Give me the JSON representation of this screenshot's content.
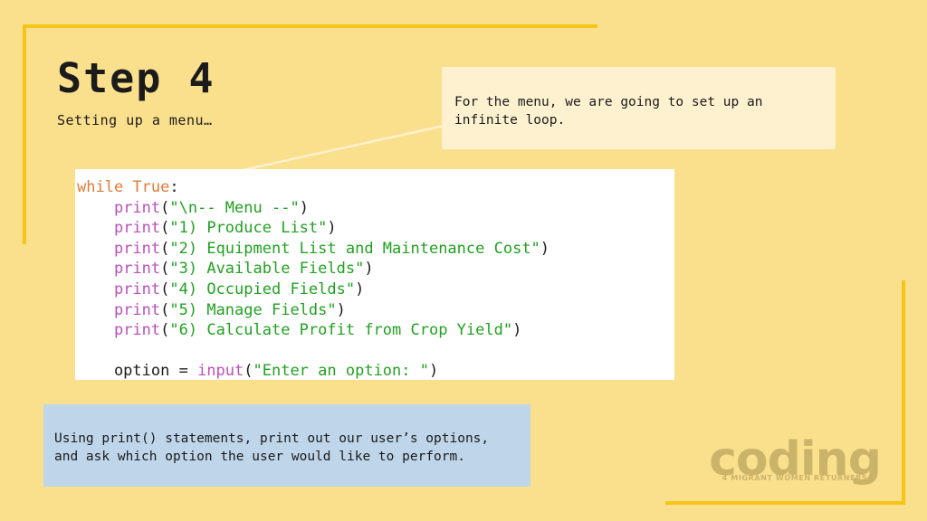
{
  "slide": {
    "background_color": "#fae08c",
    "accent_color": "#f5c518",
    "title": "Step 4",
    "subtitle": "Setting up a menu…"
  },
  "callout": {
    "background_color": "#fdf1d0",
    "text": "For the menu, we are going to set up an\ninfinite loop."
  },
  "code_block": {
    "background_color": "#ffffff",
    "language": "python",
    "lines": [
      [
        {
          "t": "while ",
          "c": "kw"
        },
        {
          "t": "True",
          "c": "kw"
        },
        {
          "t": ":",
          "c": "punct"
        }
      ],
      [
        {
          "t": "    ",
          "c": "plain"
        },
        {
          "t": "print",
          "c": "builtin"
        },
        {
          "t": "(",
          "c": "punct"
        },
        {
          "t": "\"\\n-- Menu --\"",
          "c": "str"
        },
        {
          "t": ")",
          "c": "punct"
        }
      ],
      [
        {
          "t": "    ",
          "c": "plain"
        },
        {
          "t": "print",
          "c": "builtin"
        },
        {
          "t": "(",
          "c": "punct"
        },
        {
          "t": "\"1) Produce List\"",
          "c": "str"
        },
        {
          "t": ")",
          "c": "punct"
        }
      ],
      [
        {
          "t": "    ",
          "c": "plain"
        },
        {
          "t": "print",
          "c": "builtin"
        },
        {
          "t": "(",
          "c": "punct"
        },
        {
          "t": "\"2) Equipment List and Maintenance Cost\"",
          "c": "str"
        },
        {
          "t": ")",
          "c": "punct"
        }
      ],
      [
        {
          "t": "    ",
          "c": "plain"
        },
        {
          "t": "print",
          "c": "builtin"
        },
        {
          "t": "(",
          "c": "punct"
        },
        {
          "t": "\"3) Available Fields\"",
          "c": "str"
        },
        {
          "t": ")",
          "c": "punct"
        }
      ],
      [
        {
          "t": "    ",
          "c": "plain"
        },
        {
          "t": "print",
          "c": "builtin"
        },
        {
          "t": "(",
          "c": "punct"
        },
        {
          "t": "\"4) Occupied Fields\"",
          "c": "str"
        },
        {
          "t": ")",
          "c": "punct"
        }
      ],
      [
        {
          "t": "    ",
          "c": "plain"
        },
        {
          "t": "print",
          "c": "builtin"
        },
        {
          "t": "(",
          "c": "punct"
        },
        {
          "t": "\"5) Manage Fields\"",
          "c": "str"
        },
        {
          "t": ")",
          "c": "punct"
        }
      ],
      [
        {
          "t": "    ",
          "c": "plain"
        },
        {
          "t": "print",
          "c": "builtin"
        },
        {
          "t": "(",
          "c": "punct"
        },
        {
          "t": "\"6) Calculate Profit from Crop Yield\"",
          "c": "str"
        },
        {
          "t": ")",
          "c": "punct"
        }
      ],
      [
        {
          "t": " ",
          "c": "plain"
        }
      ],
      [
        {
          "t": "    option = ",
          "c": "plain"
        },
        {
          "t": "input",
          "c": "builtin"
        },
        {
          "t": "(",
          "c": "punct"
        },
        {
          "t": "\"Enter an option: \"",
          "c": "str"
        },
        {
          "t": ")",
          "c": "punct"
        }
      ]
    ],
    "syntax_colors": {
      "keyword": "#e07b39",
      "builtin": "#bb4fbb",
      "string": "#21a121",
      "punctuation": "#1b1b1b",
      "plain": "#1b1b1b"
    }
  },
  "note_box": {
    "background_color": "#bed5ea",
    "text": "Using print() statements, print out our user’s options,\nand ask which option the user would like to perform."
  },
  "logo": {
    "word": "coding",
    "tagline": "4 MIGRANT WOMEN RETURNERS",
    "color": "#cbb36a"
  }
}
